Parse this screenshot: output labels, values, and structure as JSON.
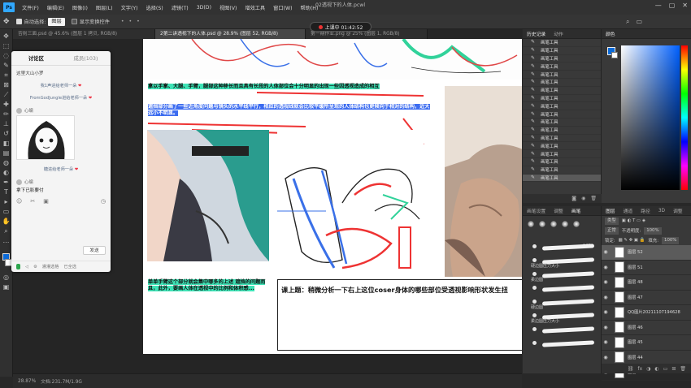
{
  "menubar": {
    "logo": "Ps",
    "items": [
      "文件(F)",
      "编辑(E)",
      "图像(I)",
      "图层(L)",
      "文字(Y)",
      "选择(S)",
      "滤镜(T)",
      "3D(D)",
      "视图(V)",
      "增效工具",
      "窗口(W)",
      "帮助(H)"
    ],
    "window_title": "02透视下的人体.pcwl",
    "controls": [
      "—",
      "▢",
      "✕"
    ]
  },
  "optbar": {
    "auto_select_label": "自动选择:",
    "auto_select_value": "图层",
    "transform_label": "显示变换控件",
    "live_label": "上课中 01:42:52",
    "dots": "• • •"
  },
  "tabs": [
    "否则三面.psd @ 45.6% (图层 1 拷贝, RGB/8)",
    "2第二讲透视下的人体.psd @ 28.9% (图层 52, RGB/8)",
    "第一期作业.png @ 25% (图层 1, RGB/8)"
  ],
  "active_tab_index": 1,
  "status": {
    "zoom": "28.87%",
    "doc": "文档:231.7M/1.9G"
  },
  "chat": {
    "tab_discuss": "讨论区",
    "tab_members": "成员(103)",
    "system_msg": "这里大山小罗",
    "notice_1": "我1声进给老师一朵",
    "notice_2": "FromGodJungle进给老师一朵",
    "user_1": "心编",
    "notice_3": "糖进给老师一朵",
    "user_2": "心编",
    "msg_2": "拿下已影要付",
    "send_label": "发送",
    "bottom_label": "灌灌选格",
    "bottom_right": "已全选"
  },
  "history": {
    "tabs": [
      "历史记录",
      "动作"
    ],
    "rows": [
      "画笔工具",
      "画笔工具",
      "画笔工具",
      "画笔工具",
      "画笔工具",
      "画笔工具",
      "画笔工具",
      "画笔工具",
      "画笔工具",
      "画笔工具",
      "画笔工具",
      "画笔工具",
      "画笔工具",
      "画笔工具",
      "画笔工具",
      "画笔工具",
      "画笔工具",
      "画笔工具"
    ],
    "active_index": 17
  },
  "color_panel": {
    "title": "颜色",
    "fg": "#0b6ad8",
    "bg": "#ffffff"
  },
  "brush_panel": {
    "tabs": [
      "画笔设置",
      "调整",
      "画笔"
    ],
    "size": "140",
    "strokes": [
      "",
      "",
      "",
      "",
      "柔边圆压力大小",
      "",
      "柔边圆压力大小",
      ""
    ],
    "labels": [
      "硬边圆压力大小",
      "柔边圆",
      "硬边圆",
      "柔边圆压力大小"
    ]
  },
  "layers": {
    "tabs": [
      "图层",
      "通道",
      "路径",
      "3D",
      "调整"
    ],
    "filter_label": "类型",
    "mode": "正常",
    "opacity_label": "不透明度:",
    "opacity": "100%",
    "fill_label": "填充:",
    "fill": "100%",
    "lock_label": "锁定:",
    "rows": [
      "图层 52",
      "图层 51",
      "图层 48",
      "图层 47",
      "QQ图片20211107194628",
      "图层 46",
      "图层 45",
      "图层 44",
      "图层 43"
    ],
    "active_index": 0
  },
  "document": {
    "block_1": "拿以手掌、大腿、手臂，腿部这种移长而且具有长段的人体部位会十分明显的出现一些因透视造成的相互",
    "block_2": "遮挡部分画了一些近角度问题与镜头的水平线平行，相应的透视线就会比较平缓所呈现的人体结构也更倾向于相对的结构，近大远小不明显。",
    "block_3": "单单手臂这个部分就会集中哪多的上述 遮挡的问题而且，此外，要画人体在透视中的比例和体积感...",
    "note_title": "课上题：稍微分析一下右上这位coser身体的哪些部位受透视影响形状发生扭"
  }
}
